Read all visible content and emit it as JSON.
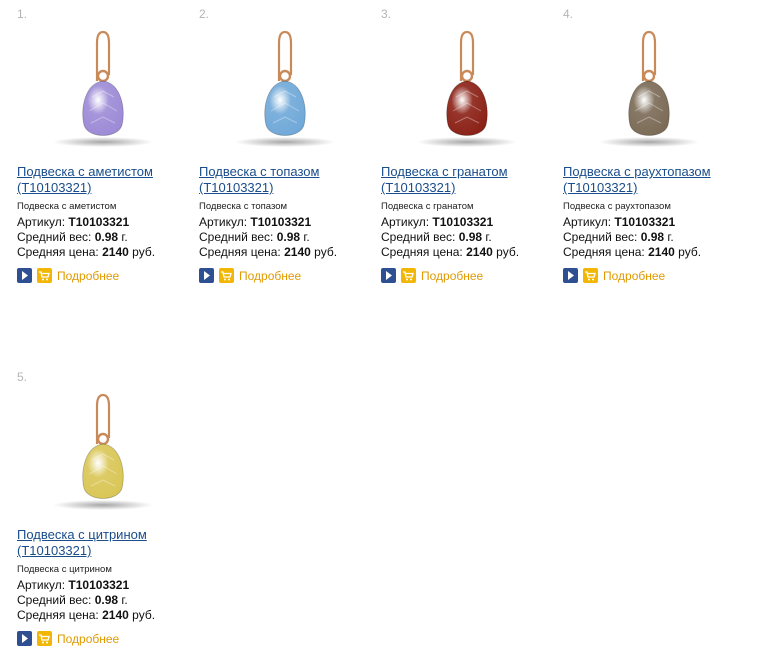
{
  "labels": {
    "article": "Артикул:",
    "weight": "Средний вес:",
    "weight_unit": "г.",
    "price": "Средняя цена:",
    "price_unit": "руб.",
    "more": "Подробнее"
  },
  "products": [
    {
      "num": "1.",
      "title": "Подвеска с аметистом (T10103321)",
      "subtitle": "Подвеска с аметистом",
      "article": "T10103321",
      "weight": "0.98",
      "price": "2140",
      "stone_color": "#9c8ad6"
    },
    {
      "num": "2.",
      "title": "Подвеска с топазом (T10103321)",
      "subtitle": "Подвеска с топазом",
      "article": "T10103321",
      "weight": "0.98",
      "price": "2140",
      "stone_color": "#6fa8d8"
    },
    {
      "num": "3.",
      "title": "Подвеска с гранатом (T10103321)",
      "subtitle": "Подвеска с гранатом",
      "article": "T10103321",
      "weight": "0.98",
      "price": "2140",
      "stone_color": "#8a1f14"
    },
    {
      "num": "4.",
      "title": "Подвеска с раухтопазом (T10103321)",
      "subtitle": "Подвеска с раухтопазом",
      "article": "T10103321",
      "weight": "0.98",
      "price": "2140",
      "stone_color": "#7a6a55"
    },
    {
      "num": "5.",
      "title": "Подвеска с цитрином (T10103321)",
      "subtitle": "Подвеска с цитрином",
      "article": "T10103321",
      "weight": "0.98",
      "price": "2140",
      "stone_color": "#d9c655"
    }
  ]
}
